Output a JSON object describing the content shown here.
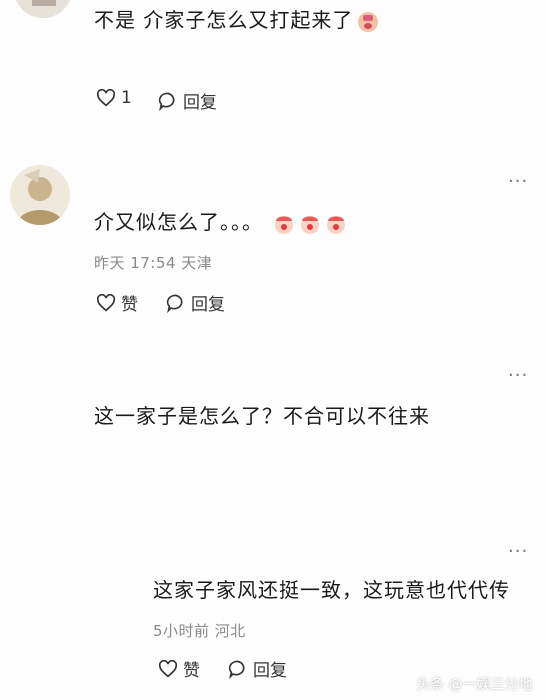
{
  "comments": [
    {
      "text": "不是 介家子怎么又打起来了",
      "emoji": [
        "crying-face"
      ],
      "like_label": "1",
      "reply_label": "回复"
    },
    {
      "text": "介又似怎么了。。。",
      "emoji": [
        "clown-face",
        "clown-face",
        "clown-face"
      ],
      "meta": "昨天 17:54 天津",
      "like_label": "赞",
      "reply_label": "回复",
      "more": "..."
    },
    {
      "text": "这一家子是怎么了？不合可以不往来",
      "more": "..."
    },
    {
      "text": "这家子家风还挺一致，这玩意也代代传",
      "meta": "5小时前 河北",
      "like_label": "赞",
      "reply_label": "回复",
      "more": "..."
    }
  ],
  "watermark": "头条 @一娱三分地",
  "colors": {
    "background": "#fdfdfd",
    "text": "#1a1a1a",
    "meta": "#8a8a8a"
  }
}
